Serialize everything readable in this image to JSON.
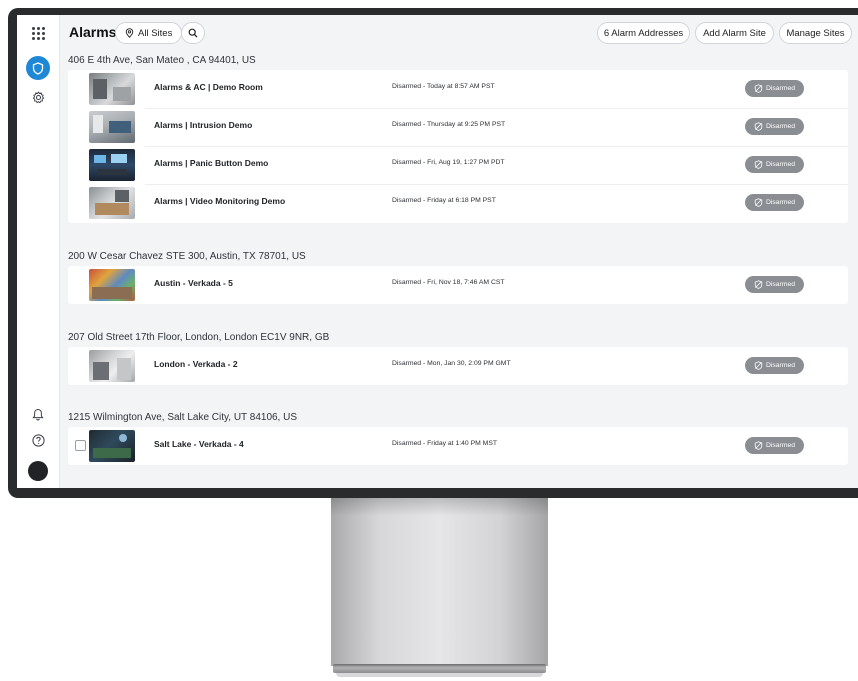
{
  "header": {
    "title": "Alarms",
    "all_sites_label": "All Sites",
    "alarm_addresses_label": "6 Alarm Addresses",
    "add_alarm_site_label": "Add Alarm Site",
    "manage_sites_label": "Manage Sites"
  },
  "rail": {
    "icons": [
      "apps-grid-icon",
      "alarm-shield-icon",
      "settings-gear-icon",
      "notifications-bell-icon",
      "help-icon",
      "user-avatar"
    ]
  },
  "sites": [
    {
      "address": "406 E 4th Ave, San Mateo , CA 94401, US",
      "rows": [
        {
          "name": "Alarms & AC | Demo Room",
          "status": "Disarmed - Today at 8:57 AM PST",
          "badge": "Disarmed"
        },
        {
          "name": "Alarms | Intrusion Demo",
          "status": "Disarmed - Thursday at 9:25 PM PST",
          "badge": "Disarmed"
        },
        {
          "name": "Alarms | Panic Button Demo",
          "status": "Disarmed - Fri, Aug 19, 1:27 PM PDT",
          "badge": "Disarmed"
        },
        {
          "name": "Alarms | Video Monitoring Demo",
          "status": "Disarmed - Friday at 6:18 PM PST",
          "badge": "Disarmed"
        }
      ]
    },
    {
      "address": "200 W Cesar Chavez STE 300, Austin, TX 78701, US",
      "rows": [
        {
          "name": "Austin - Verkada - 5",
          "status": "Disarmed - Fri, Nov 18, 7:46 AM CST",
          "badge": "Disarmed"
        }
      ]
    },
    {
      "address": "207 Old Street 17th Floor, London, London EC1V 9NR, GB",
      "rows": [
        {
          "name": "London - Verkada - 2",
          "status": "Disarmed - Mon, Jan 30, 2:09 PM GMT",
          "badge": "Disarmed"
        }
      ]
    },
    {
      "address": "1215 Wilmington Ave, Salt Lake City, UT 84106, US",
      "rows": [
        {
          "name": "Salt Lake - Verkada - 4",
          "status": "Disarmed - Friday at 1:40 PM MST",
          "badge": "Disarmed"
        }
      ]
    }
  ],
  "colors": {
    "accent": "#1e88d6",
    "badge_bg": "#8a8e93",
    "screen_bg": "#f3f4f6",
    "bezel": "#2a2b2d"
  }
}
